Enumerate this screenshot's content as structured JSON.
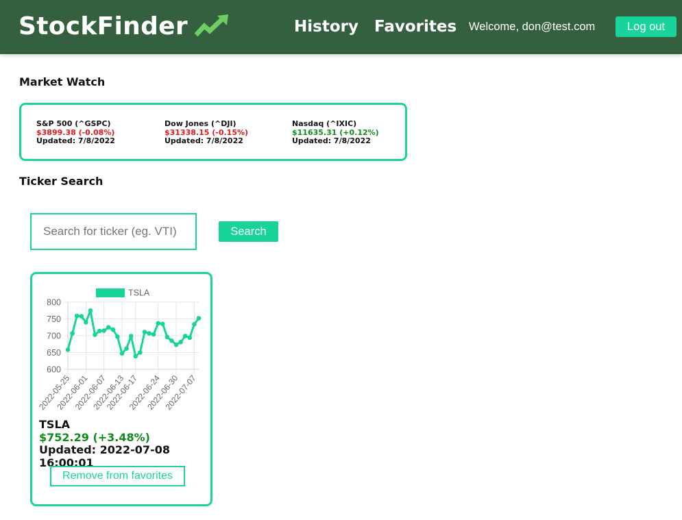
{
  "app": {
    "brand": "StockFinder",
    "brand_icon": "trending-up-icon",
    "colors": {
      "header_bg": "#356040",
      "accent": "#18d49a",
      "up": "#0f8a1b",
      "down": "#e3161a"
    }
  },
  "nav": {
    "history": "History",
    "favorites": "Favorites",
    "welcome": "Welcome, don@test.com",
    "logout": "Log out"
  },
  "market": {
    "title": "Market Watch",
    "indexes": [
      {
        "name": "S&P 500 (^GSPC)",
        "price": "$3899.38 (-0.08%)",
        "direction": "down",
        "updated": "Updated: 7/8/2022"
      },
      {
        "name": "Dow Jones (^DJI)",
        "price": "$31338.15 (-0.15%)",
        "direction": "down",
        "updated": "Updated: 7/8/2022"
      },
      {
        "name": "Nasdaq (^IXIC)",
        "price": "$11635.31 (+0.12%)",
        "direction": "up",
        "updated": "Updated: 7/8/2022"
      }
    ]
  },
  "search": {
    "title": "Ticker Search",
    "placeholder": "Search for ticker (eg. VTI)",
    "value": "",
    "button": "Search"
  },
  "card": {
    "symbol": "TSLA",
    "change": "$752.29 (+3.48%)",
    "updated": "Updated: 2022-07-08 16:00:01",
    "remove": "Remove from favorites"
  },
  "chart_data": {
    "type": "line",
    "legend": "TSLA",
    "legend_position": "top",
    "grid": true,
    "ylim": [
      600,
      800
    ],
    "y_ticks": [
      "800",
      "750",
      "700",
      "650",
      "600"
    ],
    "x_tick_labels": [
      "2022-05-25",
      "2022-06-01",
      "2022-06-07",
      "2022-06-13",
      "2022-06-17",
      "2022-06-24",
      "2022-06-30",
      "2022-07-07"
    ],
    "x_tick_index": [
      0,
      4,
      8,
      12,
      15,
      20,
      24,
      28
    ],
    "series": [
      {
        "name": "TSLA",
        "color": "#18d49a",
        "values": [
          658,
          707,
          759,
          758,
          740,
          775,
          703,
          714,
          715,
          725,
          718,
          697,
          647,
          662,
          699,
          639,
          650,
          711,
          707,
          704,
          737,
          735,
          696,
          685,
          673,
          681,
          699,
          694,
          734,
          752
        ]
      }
    ]
  }
}
